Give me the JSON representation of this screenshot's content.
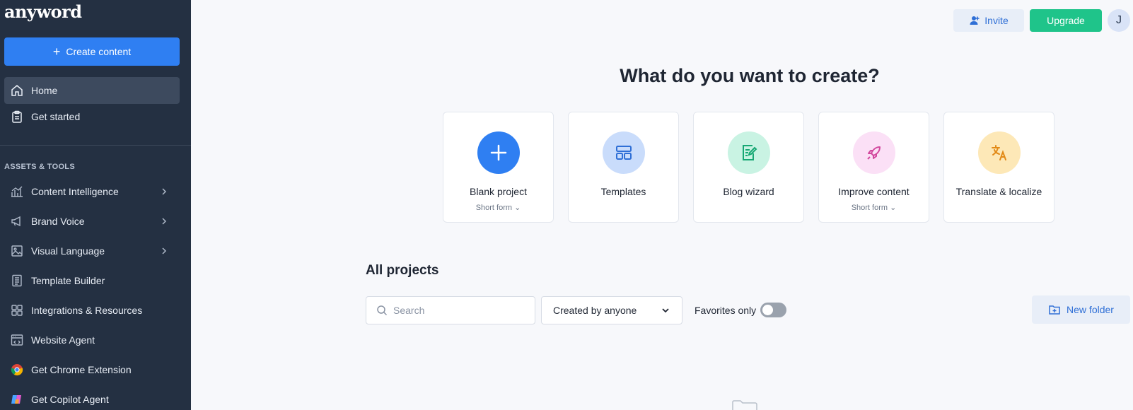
{
  "sidebar": {
    "logo": "anyword",
    "create_button": "Create content",
    "nav_top": [
      {
        "label": "Home",
        "icon": "home-icon"
      },
      {
        "label": "Get started",
        "icon": "clipboard-icon"
      }
    ],
    "section_title": "ASSETS & TOOLS",
    "tools": [
      {
        "label": "Content Intelligence",
        "icon": "chart-icon"
      },
      {
        "label": "Brand Voice",
        "icon": "megaphone-icon"
      },
      {
        "label": "Visual Language",
        "icon": "image-icon"
      },
      {
        "label": "Template Builder",
        "icon": "template-icon"
      },
      {
        "label": "Integrations & Resources",
        "icon": "grid-icon"
      },
      {
        "label": "Website Agent",
        "icon": "browser-icon"
      },
      {
        "label": "Get Chrome Extension",
        "icon": "chrome-icon"
      },
      {
        "label": "Get Copilot Agent",
        "icon": "copilot-icon"
      }
    ]
  },
  "header": {
    "invite": "Invite",
    "upgrade": "Upgrade",
    "avatar_initial": "J"
  },
  "main": {
    "title": "What do you want to create?",
    "cards": [
      {
        "label": "Blank project",
        "sub": "Short form ⌄"
      },
      {
        "label": "Templates",
        "sub": ""
      },
      {
        "label": "Blog wizard",
        "sub": ""
      },
      {
        "label": "Improve content",
        "sub": "Short form ⌄"
      },
      {
        "label": "Translate & localize",
        "sub": ""
      }
    ],
    "projects_title": "All projects",
    "search_placeholder": "Search",
    "created_by": "Created by anyone",
    "favorites_label": "Favorites only",
    "new_folder": "New folder"
  },
  "colors": {
    "sidebar_bg": "#243042",
    "primary": "#2f7ff2",
    "upgrade": "#1fc48a"
  }
}
